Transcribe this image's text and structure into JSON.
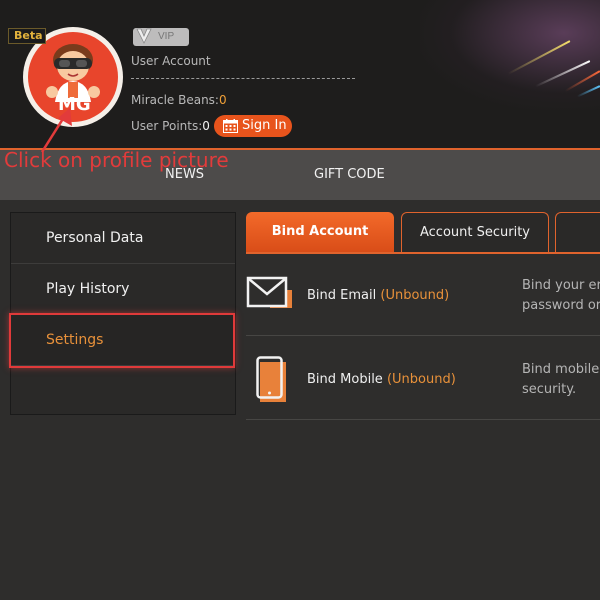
{
  "header": {
    "beta_label": "Beta",
    "vip_label": "VIP",
    "account_label": "User Account",
    "beans_label": "Miracle Beans:",
    "beans_value": "0",
    "points_label": "User Points:",
    "points_value": "0",
    "signin_label": "Sign In",
    "avatar_text": "MG"
  },
  "annotation": {
    "text": "Click on profile picture",
    "color": "#e23b3b"
  },
  "nav": {
    "items": [
      "NEWS",
      "GIFT CODE"
    ]
  },
  "sidebar": {
    "items": [
      {
        "label": "Personal Data"
      },
      {
        "label": "Play History"
      },
      {
        "label": "Settings"
      }
    ],
    "active_index": 2
  },
  "tabs": {
    "items": [
      "Bind Account",
      "Account Security"
    ],
    "active_index": 0
  },
  "bind_items": [
    {
      "title": "Bind Email",
      "status": "(Unbound)",
      "desc_line1": "Bind your er",
      "desc_line2": "password or",
      "icon": "envelope-icon"
    },
    {
      "title": "Bind Mobile",
      "status": "(Unbound)",
      "desc_line1": "Bind mobile",
      "desc_line2": "security.",
      "icon": "mobile-phone-icon"
    }
  ],
  "colors": {
    "accent": "#e8541c",
    "status": "#e8913a",
    "header_bg": "#1e1d1c",
    "body_bg": "#2e2d2c"
  }
}
